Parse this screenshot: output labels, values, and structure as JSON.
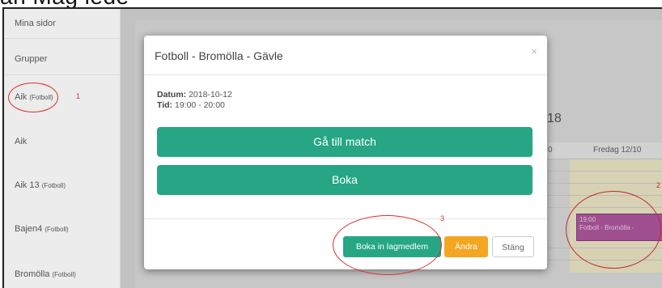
{
  "partial_top_text": "an Mag lede",
  "sidebar": {
    "items": [
      {
        "label": "Mina sidor",
        "sub": ""
      },
      {
        "label": "Grupper",
        "sub": ""
      },
      {
        "label": "Aik",
        "sub": "(Fotboll)"
      },
      {
        "label": "Aik",
        "sub": ""
      },
      {
        "label": "Aik 13",
        "sub": "(Fotboll)"
      },
      {
        "label": "Bajen4",
        "sub": "(Fotboll)"
      },
      {
        "label": "Bromölla",
        "sub": "(Fotboll)"
      }
    ]
  },
  "annotations": {
    "one": "1",
    "two": "2",
    "three": "3"
  },
  "calendar": {
    "year_fragment": "18",
    "col_prev_fragment": "0",
    "col_day": "Fredag 12/10",
    "event_time": "19:00",
    "event_title": "Fotboll - Bromölla -"
  },
  "modal": {
    "title": "Fotboll - Bromölla - Gävle",
    "close": "×",
    "date_label": "Datum:",
    "date_value": "2018-10-12",
    "time_label": "Tid:",
    "time_value": "19:00 - 20:00",
    "goto_match": "Gå till match",
    "book": "Boka",
    "book_member": "Boka in lagmedlem",
    "change": "Ändra",
    "close_btn": "Stäng"
  },
  "colors": {
    "green": "#26a685",
    "orange": "#f4a623",
    "event": "#b55aa4",
    "annotation": "#d9302c"
  }
}
